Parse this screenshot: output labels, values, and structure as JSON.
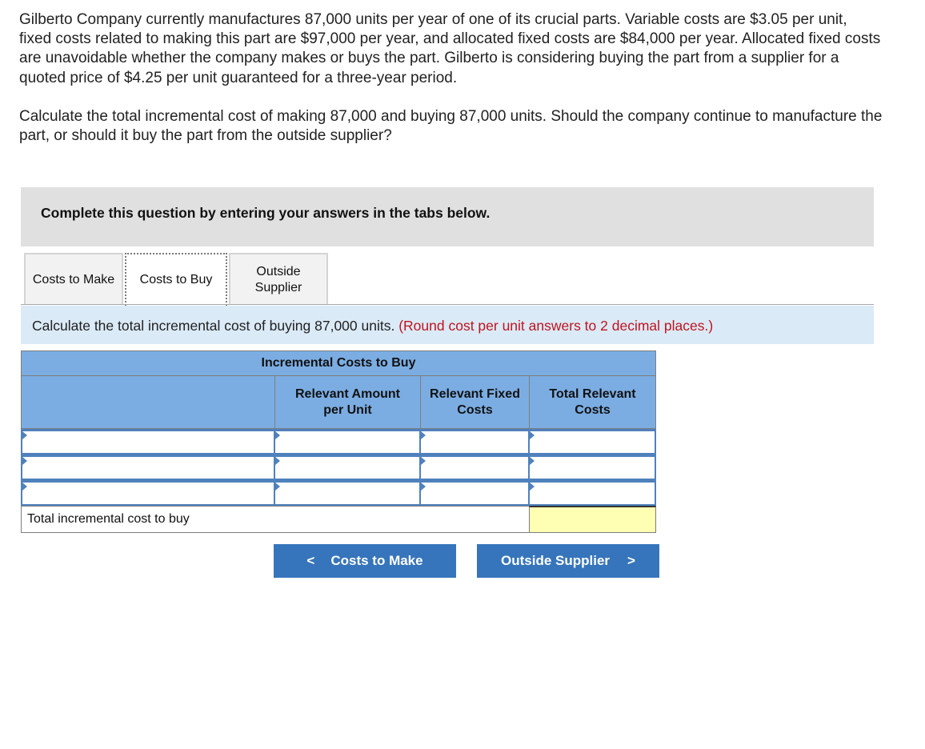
{
  "problem": {
    "paragraph1": "Gilberto Company currently manufactures 87,000 units per year of one of its crucial parts. Variable costs are $3.05 per unit, fixed costs related to making this part are $97,000 per year, and allocated fixed costs are $84,000 per year. Allocated fixed costs are unavoidable whether the company makes or buys the part. Gilberto is considering buying the part from a supplier for a quoted price of $4.25 per unit guaranteed for a three-year period.",
    "paragraph2": "Calculate the total incremental cost of making 87,000 and buying 87,000 units. Should the company continue to manufacture the part, or should it buy the part from the outside supplier?"
  },
  "instruction": "Complete this question by entering your answers in the tabs below.",
  "tabs": [
    {
      "label": "Costs to Make",
      "active": false
    },
    {
      "label": "Costs to Buy",
      "active": true
    },
    {
      "label": "Outside Supplier",
      "active": false
    }
  ],
  "prompt": {
    "text": "Calculate the total incremental cost of buying 87,000 units.",
    "note": "(Round cost per unit answers to 2 decimal places.)"
  },
  "table": {
    "title": "Incremental Costs to Buy",
    "headers": [
      "",
      "Relevant Amount per Unit",
      "Relevant Fixed Costs",
      "Total Relevant Costs"
    ],
    "rows": [
      [
        "",
        "",
        "",
        ""
      ],
      [
        "",
        "",
        "",
        ""
      ],
      [
        "",
        "",
        "",
        ""
      ]
    ],
    "total_label": "Total incremental cost to buy",
    "total_value": ""
  },
  "nav": {
    "prev_label": "Costs to Make",
    "next_label": "Outside Supplier"
  },
  "colors": {
    "header_blue": "#7bade3",
    "row_blue": "#4f81bd",
    "button_blue": "#3675bb",
    "note_red": "#c0141e",
    "total_yellow": "#ffffb3"
  }
}
